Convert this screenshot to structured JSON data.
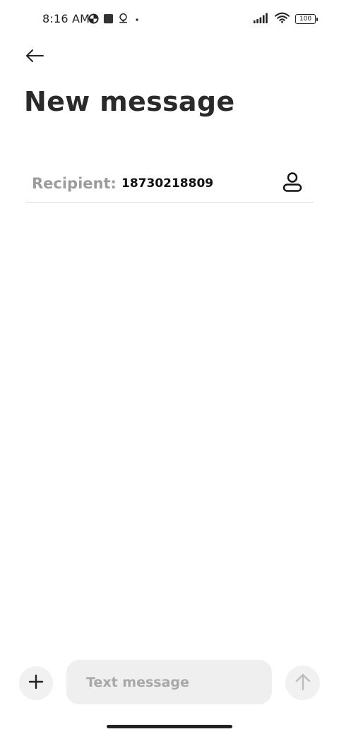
{
  "status_bar": {
    "time": "8:16 AM",
    "battery_level": "100",
    "icons_left": [
      "data-saver-icon",
      "square-app-icon",
      "location-pin-icon",
      "dot-icon"
    ],
    "icons_right": [
      "signal-icon",
      "wifi-icon",
      "battery-icon"
    ]
  },
  "header": {
    "back_icon": "arrow-left-icon",
    "title": "New message"
  },
  "recipient": {
    "label": "Recipient:",
    "value": "18730218809",
    "contact_icon": "person-icon"
  },
  "compose": {
    "attach_icon": "plus-icon",
    "placeholder": "Text message",
    "value": "",
    "send_icon": "arrow-up-icon"
  },
  "colors": {
    "background": "#ffffff",
    "text_primary": "#222222",
    "text_muted": "#9c9c9c",
    "input_bg": "#efefef",
    "button_bg": "#f1f1f1",
    "divider": "#dedede"
  }
}
